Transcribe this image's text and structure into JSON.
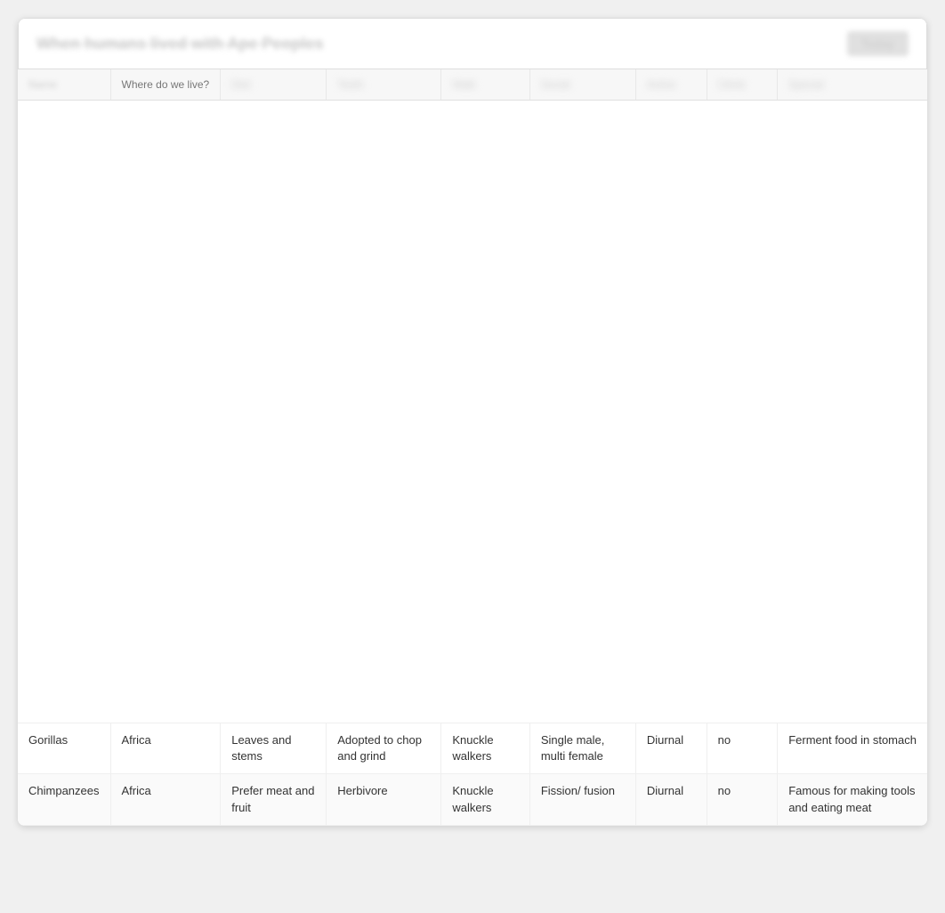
{
  "header": {
    "title": "When humans lived with Ape Peoples",
    "action_label": "Today"
  },
  "table": {
    "columns": [
      {
        "id": "name",
        "label": "Name",
        "blurred": false
      },
      {
        "id": "where",
        "label": "Where do we live?",
        "blurred": false
      },
      {
        "id": "diet",
        "label": "Diet",
        "blurred": true
      },
      {
        "id": "teeth",
        "label": "Teeth",
        "blurred": true
      },
      {
        "id": "walk",
        "label": "Walk",
        "blurred": true
      },
      {
        "id": "social",
        "label": "Social",
        "blurred": true
      },
      {
        "id": "active",
        "label": "Active",
        "blurred": true
      },
      {
        "id": "climb",
        "label": "Climb",
        "blurred": true
      },
      {
        "id": "special",
        "label": "Special",
        "blurred": true
      }
    ],
    "rows": [
      {
        "name": "Gorillas",
        "where": "Africa",
        "diet": "Leaves and stems",
        "teeth": "Adopted to chop and grind",
        "walk": "Knuckle walkers",
        "social": "Single male, multi female",
        "active": "Diurnal",
        "climb": "no",
        "special": "Ferment food in stomach"
      },
      {
        "name": "Chimpanzees",
        "where": "Africa",
        "diet": "Prefer meat and fruit",
        "teeth": "Herbivore",
        "walk": "Knuckle walkers",
        "social": "Fission/ fusion",
        "active": "Diurnal",
        "climb": "no",
        "special": "Famous for making tools and eating meat"
      }
    ]
  }
}
